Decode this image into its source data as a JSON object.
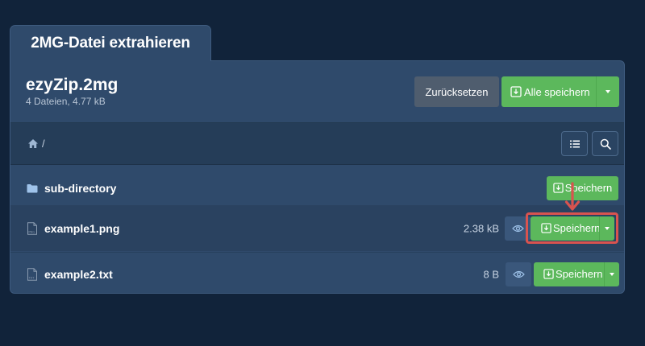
{
  "tab": {
    "title": "2MG-Datei extrahieren"
  },
  "archive": {
    "name": "ezyZip.2mg",
    "meta": "4 Dateien, 4.77 kB"
  },
  "header_buttons": {
    "reset_label": "Zurücksetzen",
    "save_all_label": "Alle speichern"
  },
  "breadcrumb": {
    "path": "/"
  },
  "toolbar_icons": [
    "list-icon",
    "search-icon"
  ],
  "files": [
    {
      "type": "folder",
      "name": "sub-directory",
      "size": "",
      "save_label": "Speichern"
    },
    {
      "type": "png",
      "name": "example1.png",
      "size": "2.38 kB",
      "save_label": "Speichern",
      "icon_tag": "PNG"
    },
    {
      "type": "txt",
      "name": "example2.txt",
      "size": "8 B",
      "save_label": "Speichern",
      "icon_tag": "TXT"
    }
  ],
  "colors": {
    "background": "#11233a",
    "panel": "#2f4a6b",
    "accent_green": "#5cb85c",
    "highlight_red": "#d9534f",
    "reset_gray": "#4f5d6e"
  }
}
